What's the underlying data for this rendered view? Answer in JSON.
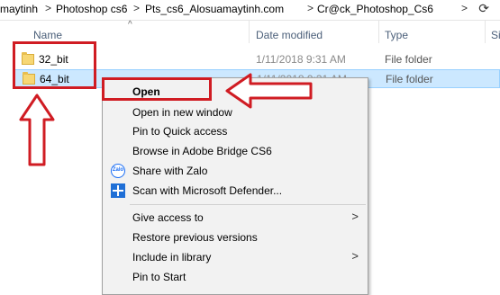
{
  "breadcrumb": {
    "items": [
      "maytinh",
      "Photoshop cs6",
      "Pts_cs6_Alosuamaytinh.com",
      "Cr@ck_Photoshop_Cs6"
    ],
    "separator": ">"
  },
  "columns": {
    "name": "Name",
    "date_modified": "Date modified",
    "type": "Type",
    "size": "Si"
  },
  "files": [
    {
      "name": "32_bit",
      "date": "1/11/2018 9:31 AM",
      "type": "File folder"
    },
    {
      "name": "64_bit",
      "date": "1/11/2018 9:31 AM",
      "type": "File folder"
    }
  ],
  "context_menu": {
    "items": [
      {
        "label": "Open",
        "bold": true
      },
      {
        "label": "Open in new window"
      },
      {
        "label": "Pin to Quick access"
      },
      {
        "label": "Browse in Adobe Bridge CS6"
      },
      {
        "label": "Share with Zalo",
        "icon": "zalo-icon",
        "icon_text": "Zalo"
      },
      {
        "label": "Scan with Microsoft Defender...",
        "icon": "defender-icon"
      },
      {
        "label": "Give access to",
        "submenu": true
      },
      {
        "label": "Restore previous versions"
      },
      {
        "label": "Include in library",
        "submenu": true
      },
      {
        "label": "Pin to Start"
      }
    ]
  },
  "colors": {
    "highlight": "#d01c23",
    "selection": "#cce8ff",
    "header_text": "#4c607a"
  }
}
